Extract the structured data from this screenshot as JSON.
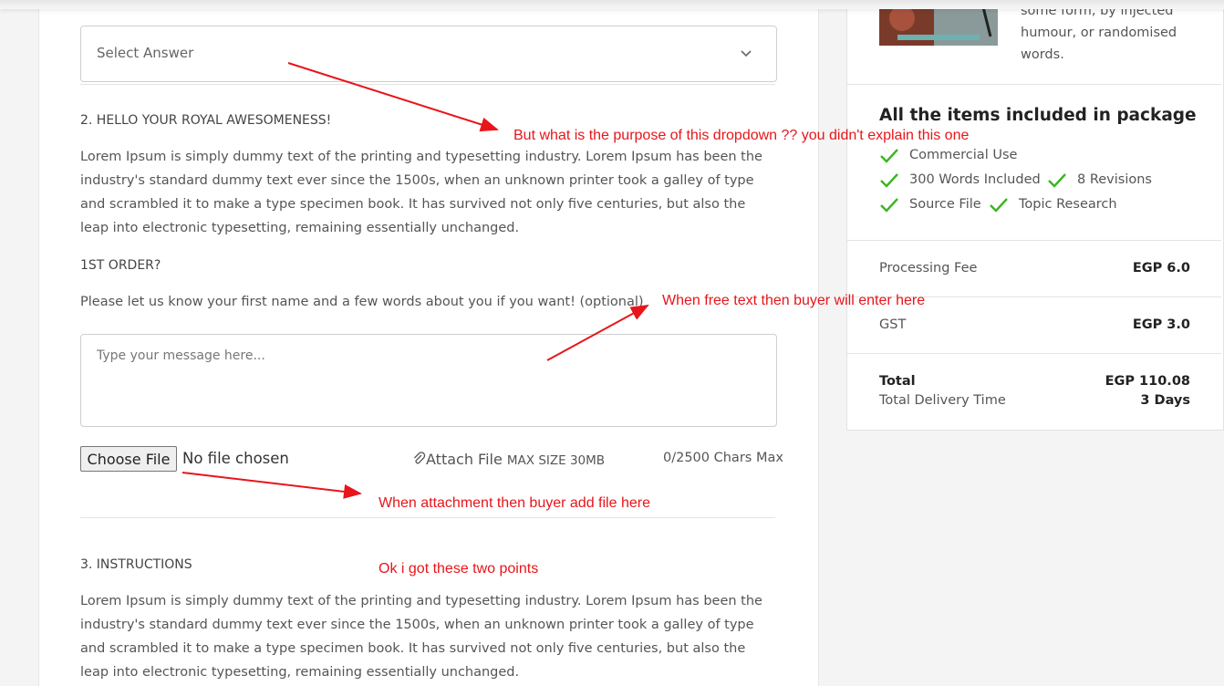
{
  "question_select": {
    "placeholder": "Select Answer"
  },
  "section2": {
    "heading": "2. HELLO YOUR ROYAL AWESOMENESS!",
    "paragraph": "Lorem Ipsum is simply dummy text of the printing and typesetting industry. Lorem Ipsum has been the industry's standard dummy text ever since the 1500s, when an unknown printer took a galley of type and scrambled it to make a type specimen book. It has survived not only five centuries, but also the leap into electronic typesetting, remaining essentially unchanged.",
    "subheading": "1ST ORDER?",
    "prompt": "Please let us know your first name and a few words about you if you want! (optional)",
    "message_placeholder": "Type your message here...",
    "file_button": "Choose File",
    "file_status": "No file chosen",
    "attach_label": "Attach File",
    "attach_max": "MAX SIZE 30MB",
    "char_counter": "0/2500 Chars Max"
  },
  "section3": {
    "heading": "3. INSTRUCTIONS",
    "paragraph": "Lorem Ipsum is simply dummy text of the printing and typesetting industry. Lorem Ipsum has been the industry's standard dummy text ever since the 1500s, when an unknown printer took a galley of type and scrambled it to make a type specimen book. It has survived not only five centuries, but also the leap into electronic typesetting, remaining essentially unchanged."
  },
  "sidebar": {
    "description_tail": "some form, by injected humour, or randomised words.",
    "package_title": "All the items included in package",
    "items": [
      "Commercial Use",
      "300 Words Included",
      "8 Revisions",
      "Source File",
      "Topic Research"
    ],
    "fees": [
      {
        "label": "Processing Fee",
        "value": "EGP 6.0"
      },
      {
        "label": "GST",
        "value": "EGP 3.0"
      }
    ],
    "total_label": "Total",
    "total_value": "EGP 110.08",
    "delivery_label": "Total Delivery Time",
    "delivery_value": "3 Days"
  },
  "annotations": {
    "dropdown_note": "But what is the purpose of this dropdown ?? you didn't explain this one",
    "text_note": "When free text then buyer will enter here",
    "attach_note": "When attachment then buyer add file here",
    "ok_note": "Ok i got these two points"
  },
  "colors": {
    "annotation": "#e8151a",
    "check": "#3cb521",
    "page_bg": "#f4f4f4"
  },
  "icons": [
    "chevron-down-icon",
    "paperclip-icon",
    "check-icon"
  ]
}
